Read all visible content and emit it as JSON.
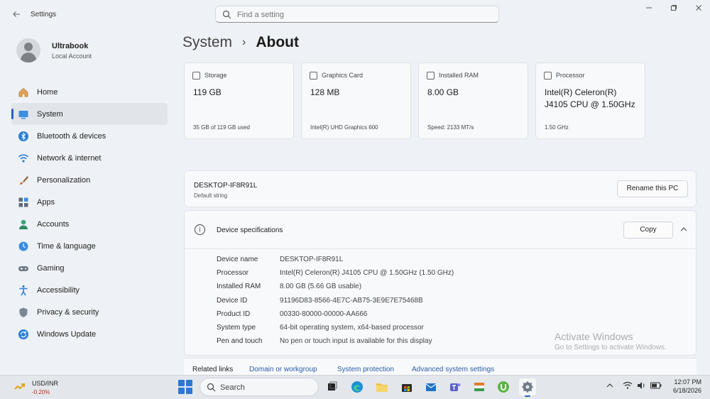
{
  "window": {
    "title": "Settings",
    "search_placeholder": "Find a setting"
  },
  "profile": {
    "name": "Ultrabook",
    "account_type": "Local Account"
  },
  "sidebar": {
    "items": [
      {
        "label": "Home",
        "icon": "home-icon"
      },
      {
        "label": "System",
        "icon": "system-icon",
        "active": true
      },
      {
        "label": "Bluetooth & devices",
        "icon": "bluetooth-icon"
      },
      {
        "label": "Network & internet",
        "icon": "wifi-icon"
      },
      {
        "label": "Personalization",
        "icon": "brush-icon"
      },
      {
        "label": "Apps",
        "icon": "apps-icon"
      },
      {
        "label": "Accounts",
        "icon": "accounts-icon"
      },
      {
        "label": "Time & language",
        "icon": "globe-clock-icon"
      },
      {
        "label": "Gaming",
        "icon": "gamepad-icon"
      },
      {
        "label": "Accessibility",
        "icon": "accessibility-icon"
      },
      {
        "label": "Privacy & security",
        "icon": "shield-icon"
      },
      {
        "label": "Windows Update",
        "icon": "update-icon"
      }
    ]
  },
  "breadcrumb": {
    "parent": "System",
    "separator": "›",
    "current": "About"
  },
  "cards": [
    {
      "label": "Storage",
      "value": "119 GB",
      "sub": "35 GB of 119 GB used"
    },
    {
      "label": "Graphics Card",
      "value": "128 MB",
      "sub": "Intel(R) UHD Graphics 600"
    },
    {
      "label": "Installed RAM",
      "value": "8.00 GB",
      "sub": "Speed: 2133 MT/s"
    },
    {
      "label": "Processor",
      "value_line1": "Intel(R) Celeron(R)",
      "value_line2": "J4105 CPU @ 1.50GHz",
      "sub": "1.50 GHz"
    }
  ],
  "pc": {
    "name": "DESKTOP-IF8R91L",
    "sub": "Default string",
    "rename_label": "Rename this PC"
  },
  "device_specs": {
    "title": "Device specifications",
    "copy_label": "Copy",
    "rows": [
      {
        "key": "Device name",
        "value": "DESKTOP-IF8R91L"
      },
      {
        "key": "Processor",
        "value": "Intel(R) Celeron(R) J4105 CPU @ 1.50GHz (1.50 GHz)"
      },
      {
        "key": "Installed RAM",
        "value": "8.00 GB (5.66 GB usable)"
      },
      {
        "key": "Device ID",
        "value": "91196D83-8566-4E7C-AB75-3E9E7E75468B"
      },
      {
        "key": "Product ID",
        "value": "00330-80000-00000-AA666"
      },
      {
        "key": "System type",
        "value": "64-bit operating system, x64-based processor"
      },
      {
        "key": "Pen and touch",
        "value": "No pen or touch input is available for this display"
      }
    ]
  },
  "watermark": {
    "line1": "Activate Windows",
    "line2": "Go to Settings to activate Windows."
  },
  "related": {
    "label": "Related links",
    "links": [
      "Domain or workgroup",
      "System protection",
      "Advanced system settings"
    ]
  },
  "taskbar": {
    "widget_name": "USD/INR",
    "widget_value": "-0.20%",
    "search_label": "Search",
    "time": "12:07 PM",
    "date": "6/18/2026"
  },
  "colors": {
    "accent": "#2a63b8",
    "negative": "#c42b1c"
  }
}
